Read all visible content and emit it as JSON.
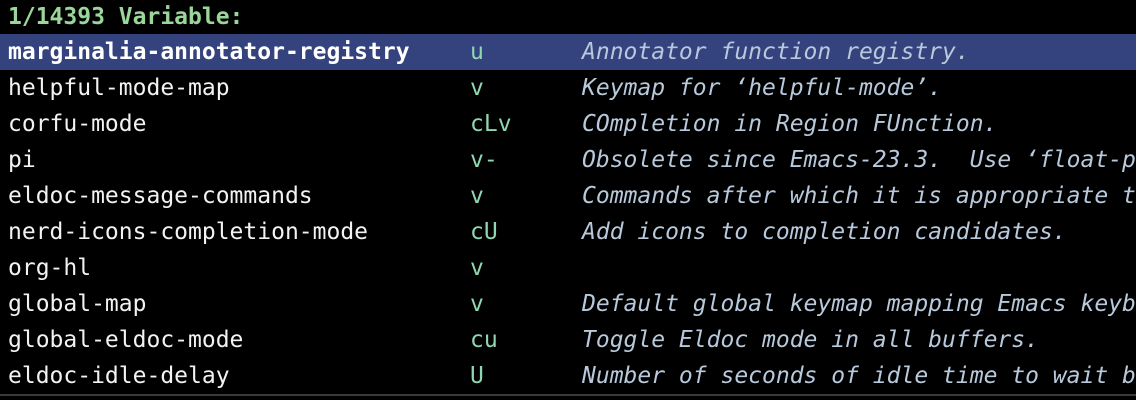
{
  "prompt": {
    "text": "1/14393 Variable:"
  },
  "candidates": [
    {
      "name": "marginalia-annotator-registry",
      "flags": "u",
      "doc": "Annotator function registry.",
      "selected": true
    },
    {
      "name": "helpful-mode-map",
      "flags": "v",
      "doc": "Keymap for ‘helpful-mode’.",
      "selected": false
    },
    {
      "name": "corfu-mode",
      "flags": "cLv",
      "doc": "COmpletion in Region FUnction.",
      "selected": false
    },
    {
      "name": "pi",
      "flags": "v-",
      "doc": "Obsolete since Emacs-23.3.  Use ‘float-p",
      "selected": false
    },
    {
      "name": "eldoc-message-commands",
      "flags": "v",
      "doc": "Commands after which it is appropriate t",
      "selected": false
    },
    {
      "name": "nerd-icons-completion-mode",
      "flags": "cU",
      "doc": "Add icons to completion candidates.",
      "selected": false
    },
    {
      "name": "org-hl",
      "flags": "v",
      "doc": "",
      "selected": false
    },
    {
      "name": "global-map",
      "flags": "v",
      "doc": "Default global keymap mapping Emacs keyb",
      "selected": false
    },
    {
      "name": "global-eldoc-mode",
      "flags": "cu",
      "doc": "Toggle Eldoc mode in all buffers.",
      "selected": false
    },
    {
      "name": "eldoc-idle-delay",
      "flags": "U",
      "doc": "Number of seconds of idle time to wait b",
      "selected": false
    }
  ],
  "colors": {
    "background": "#000000",
    "prompt": "#9ad69a",
    "selection": "#34427e",
    "flags": "#8fd7b0",
    "doc": "#b8c9dc"
  }
}
